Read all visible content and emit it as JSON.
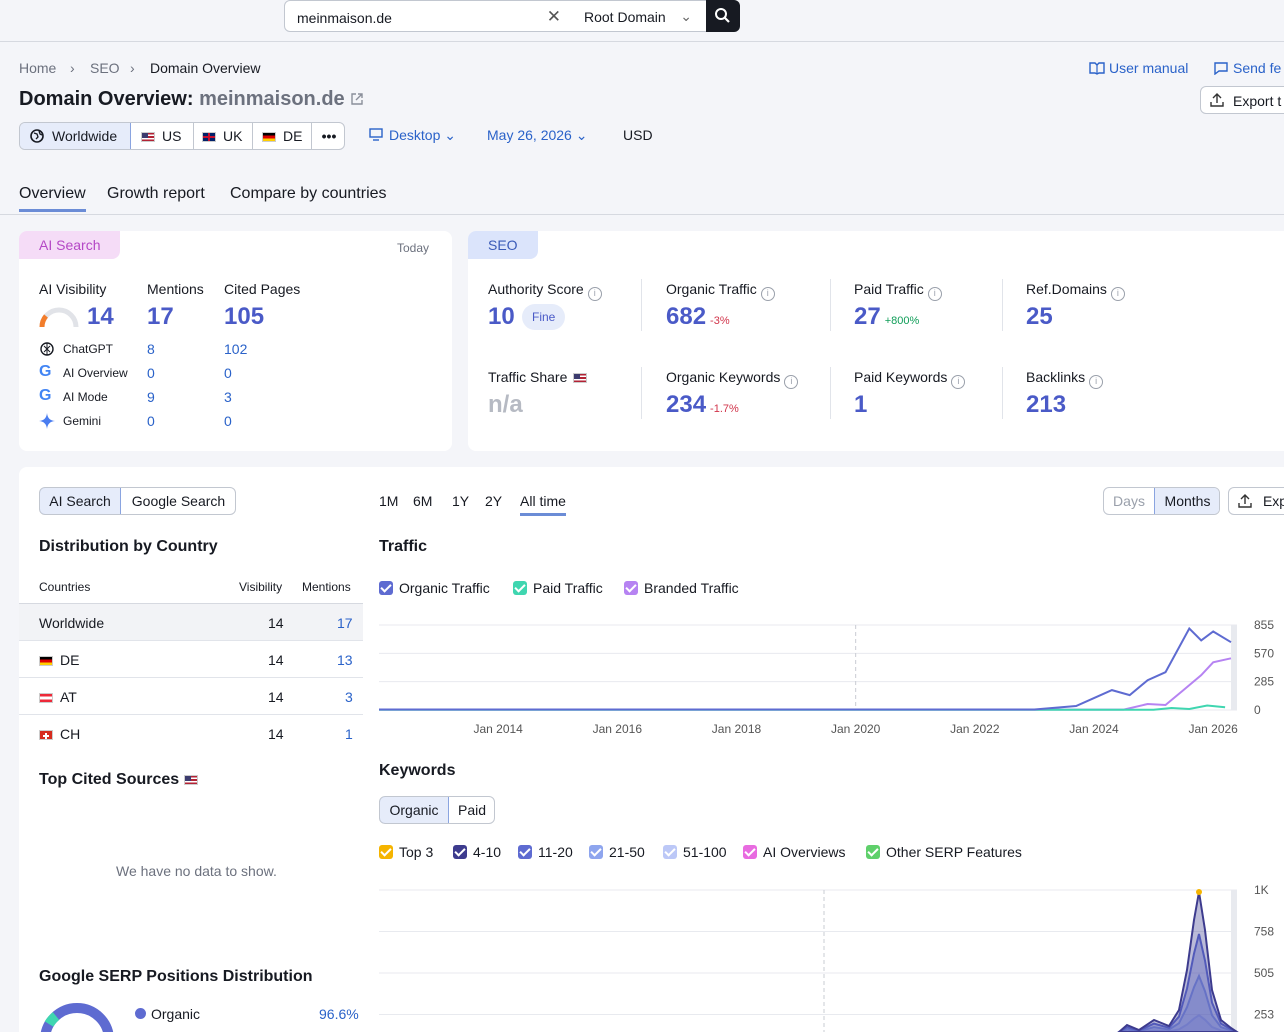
{
  "search": {
    "value": "meinmaison.de",
    "scope": "Root Domain"
  },
  "breadcrumb": [
    "Home",
    "SEO",
    "Domain Overview"
  ],
  "page": {
    "title_prefix": "Domain Overview:",
    "domain": "meinmaison.de"
  },
  "top_links": {
    "manual": "User manual",
    "feedback": "Send fe",
    "export": "Export t"
  },
  "databases": [
    {
      "label": "Worldwide",
      "flag": "globe"
    },
    {
      "label": "US",
      "flag": "us"
    },
    {
      "label": "UK",
      "flag": "uk"
    },
    {
      "label": "DE",
      "flag": "de"
    }
  ],
  "more_label": "•••",
  "controls": {
    "device": "Desktop",
    "date": "May 26, 2026",
    "currency": "USD"
  },
  "tabs": [
    "Overview",
    "Growth report",
    "Compare by countries"
  ],
  "ai_card": {
    "badge": "AI Search",
    "date": "Today",
    "visibility_label": "AI Visibility",
    "visibility": "14",
    "mentions_label": "Mentions",
    "mentions": "17",
    "cited_label": "Cited Pages",
    "cited": "105",
    "rows": [
      {
        "name": "ChatGPT",
        "mentions": "8",
        "cited": "102"
      },
      {
        "name": "AI Overview",
        "mentions": "0",
        "cited": "0"
      },
      {
        "name": "AI Mode",
        "mentions": "9",
        "cited": "3"
      },
      {
        "name": "Gemini",
        "mentions": "0",
        "cited": "0"
      }
    ]
  },
  "seo_card": {
    "badge": "SEO",
    "authority_label": "Authority Score",
    "authority": "10",
    "authority_tag": "Fine",
    "organic_label": "Organic Traffic",
    "organic": "682",
    "organic_change": "-3%",
    "paid_label": "Paid Traffic",
    "paid": "27",
    "paid_change": "+800%",
    "refdomains_label": "Ref.Domains",
    "refdomains": "25",
    "share_label": "Traffic Share",
    "share": "n/a",
    "okw_label": "Organic Keywords",
    "okw": "234",
    "okw_change": "-1.7%",
    "pkw_label": "Paid Keywords",
    "pkw": "1",
    "backlinks_label": "Backlinks",
    "backlinks": "213"
  },
  "left_panel": {
    "toggle": [
      "AI Search",
      "Google Search"
    ],
    "dist_title": "Distribution by Country",
    "cols": [
      "Countries",
      "Visibility",
      "Mentions"
    ],
    "rows": [
      {
        "country": "Worldwide",
        "flag": "",
        "visibility": "14",
        "mentions": "17"
      },
      {
        "country": "DE",
        "flag": "de",
        "visibility": "14",
        "mentions": "13"
      },
      {
        "country": "AT",
        "flag": "at",
        "visibility": "14",
        "mentions": "3"
      },
      {
        "country": "CH",
        "flag": "ch",
        "visibility": "14",
        "mentions": "1"
      }
    ],
    "cited_title": "Top Cited Sources",
    "nodata": "We have no data to show.",
    "serp_title": "Google SERP Positions Distribution",
    "serp_organic_label": "Organic",
    "serp_organic_value": "96.6%"
  },
  "periods": [
    "1M",
    "6M",
    "1Y",
    "2Y",
    "All time"
  ],
  "granularity": [
    "Days",
    "Months"
  ],
  "export_short": "Exp",
  "traffic": {
    "title": "Traffic",
    "legend": [
      {
        "label": "Organic Traffic",
        "color": "#5e6bd1"
      },
      {
        "label": "Paid Traffic",
        "color": "#3fd6b0"
      },
      {
        "label": "Branded Traffic",
        "color": "#b683f2"
      }
    ]
  },
  "keywords": {
    "title": "Keywords",
    "toggle": [
      "Organic",
      "Paid"
    ],
    "legend": [
      {
        "label": "Top 3",
        "color": "#f5b400"
      },
      {
        "label": "4-10",
        "color": "#3d3b8e"
      },
      {
        "label": "11-20",
        "color": "#5e6bd1"
      },
      {
        "label": "21-50",
        "color": "#8ea5ee"
      },
      {
        "label": "51-100",
        "color": "#bcc8f7"
      },
      {
        "label": "AI Overviews",
        "color": "#e86be0"
      },
      {
        "label": "Other SERP Features",
        "color": "#5fd06b"
      }
    ]
  },
  "chart_data": [
    {
      "type": "line",
      "title": "Traffic",
      "x": [
        "Jan 2014",
        "Jan 2016",
        "Jan 2018",
        "Jan 2020",
        "Jan 2022",
        "Jan 2024",
        "Jan 2026"
      ],
      "y_ticks": [
        "855",
        "570",
        "285",
        "0"
      ],
      "ylim": [
        0,
        855
      ],
      "series": [
        {
          "name": "Organic Traffic",
          "points": [
            [
              2012.0,
              5
            ],
            [
              2023.0,
              5
            ],
            [
              2023.7,
              40
            ],
            [
              2024.0,
              120
            ],
            [
              2024.3,
              200
            ],
            [
              2024.6,
              150
            ],
            [
              2024.9,
              300
            ],
            [
              2025.2,
              380
            ],
            [
              2025.4,
              600
            ],
            [
              2025.6,
              820
            ],
            [
              2025.8,
              700
            ],
            [
              2026.0,
              790
            ],
            [
              2026.3,
              682
            ]
          ]
        },
        {
          "name": "Paid Traffic",
          "points": [
            [
              2012.0,
              3
            ],
            [
              2025.0,
              3
            ],
            [
              2025.3,
              20
            ],
            [
              2025.6,
              10
            ],
            [
              2025.9,
              45
            ],
            [
              2026.2,
              27
            ]
          ]
        },
        {
          "name": "Branded Traffic",
          "points": [
            [
              2012.0,
              4
            ],
            [
              2024.5,
              4
            ],
            [
              2024.9,
              60
            ],
            [
              2025.2,
              50
            ],
            [
              2025.5,
              200
            ],
            [
              2025.8,
              350
            ],
            [
              2026.0,
              480
            ],
            [
              2026.3,
              520
            ]
          ]
        }
      ]
    },
    {
      "type": "area",
      "title": "Keywords",
      "y_ticks": [
        "1K",
        "758",
        "505",
        "253"
      ]
    }
  ]
}
